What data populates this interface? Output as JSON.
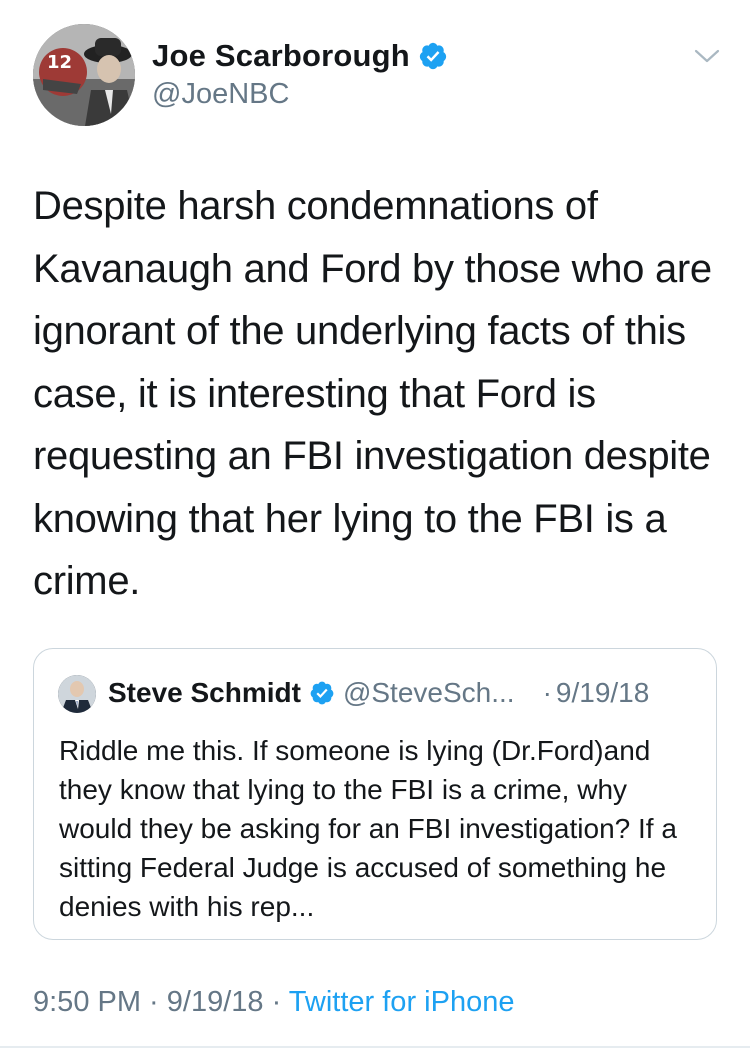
{
  "author": {
    "display_name": "Joe Scarborough",
    "handle": "@JoeNBC",
    "avatar_icon": "user-avatar-icon",
    "verified_icon": "verified-badge-icon"
  },
  "menu_icon": "chevron-down-icon",
  "tweet": {
    "text": "Despite harsh condemnations of Kavanaugh and Ford by those who are ignorant of the underlying facts of this case, it is interesting that Ford is requesting an FBI investigation despite knowing that her lying to the FBI is a crime."
  },
  "quoted_tweet": {
    "display_name": "Steve Schmidt",
    "handle": "@SteveSch...",
    "separator": "·",
    "date": "9/19/18",
    "text": "Riddle me this. If someone is lying (Dr.Ford)and they know that lying to the FBI is a crime, why would they be asking for an FBI investigation?  If a sitting Federal Judge is accused of something he denies with his rep..."
  },
  "footer": {
    "time": "9:50 PM",
    "sep1": " · ",
    "date": "9/19/18",
    "sep2": " · ",
    "source": "Twitter for iPhone"
  },
  "colors": {
    "verified_blue": "#1da1f2",
    "secondary_text": "#657786",
    "primary_text": "#14171a",
    "border": "#ccd6dd"
  }
}
